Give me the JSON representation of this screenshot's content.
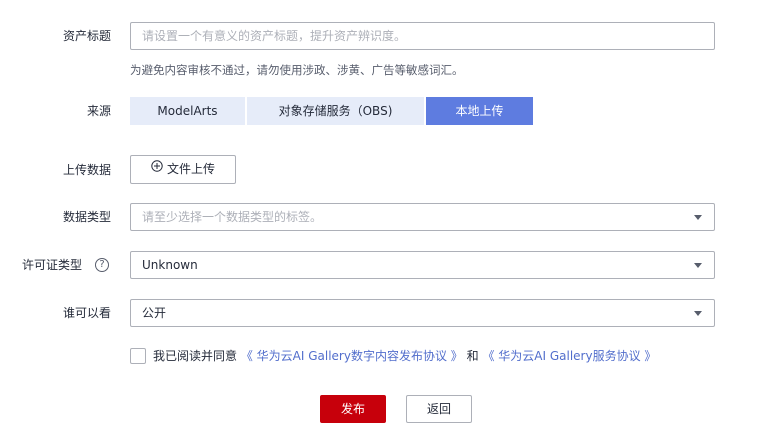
{
  "form": {
    "title": {
      "label": "资产标题",
      "placeholder": "请设置一个有意义的资产标题，提升资产辨识度。",
      "hint": "为避免内容审核不通过，请勿使用涉政、涉黄、广告等敏感词汇。"
    },
    "source": {
      "label": "来源",
      "options": [
        "ModelArts",
        "对象存储服务（OBS)",
        "本地上传"
      ],
      "selected": "本地上传"
    },
    "upload": {
      "label": "上传数据",
      "button_label": "文件上传",
      "button_icon": "plus-circle-icon"
    },
    "data_type": {
      "label": "数据类型",
      "placeholder": "请至少选择一个数据类型的标签。"
    },
    "license_type": {
      "label": "许可证类型",
      "value": "Unknown",
      "help_icon": "question-circle-icon"
    },
    "visibility": {
      "label": "谁可以看",
      "value": "公开"
    },
    "agreement": {
      "checked": false,
      "prefix": "我已阅读并同意",
      "link1": "《 华为云AI Gallery数字内容发布协议 》",
      "conjunction": "和",
      "link2": "《 华为云AI Gallery服务协议 》"
    },
    "actions": {
      "publish_label": "发布",
      "back_label": "返回"
    }
  },
  "colors": {
    "primary": "#c7000b",
    "segment_active": "#5e7ce0",
    "segment_inactive": "#e6ecf9",
    "link": "#526ecc",
    "border": "#adb0b8"
  }
}
